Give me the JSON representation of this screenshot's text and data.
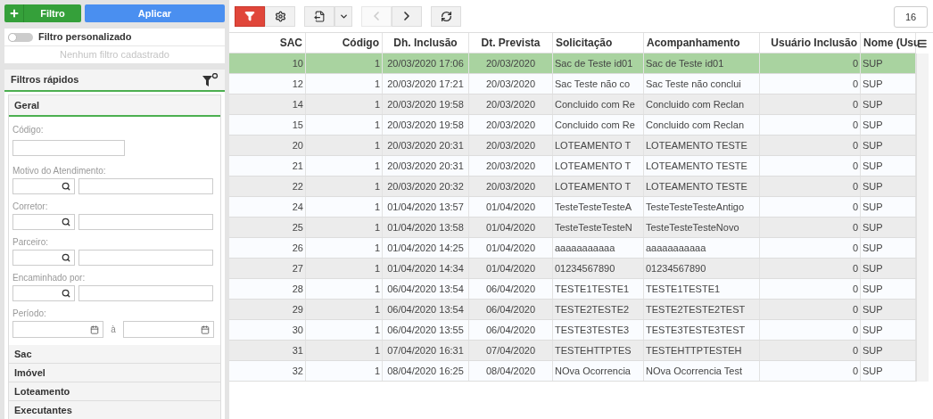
{
  "left_toolbar": {
    "add_button": "Filtro",
    "apply_button": "Aplicar"
  },
  "custom_filter": {
    "label": "Filtro personalizado",
    "on": false,
    "empty_message": "Nenhum filtro cadastrado"
  },
  "quick_filters": {
    "title": "Filtros rápidos",
    "sections": [
      {
        "title": "Geral",
        "expanded": true,
        "fields": [
          {
            "kind": "text",
            "label": "Código:"
          },
          {
            "kind": "lookup",
            "label": "Motivo do Atendimento:"
          },
          {
            "kind": "lookup",
            "label": "Corretor:"
          },
          {
            "kind": "lookup",
            "label": "Parceiro:"
          },
          {
            "kind": "lookup",
            "label": "Encaminhado por:"
          },
          {
            "kind": "date_range",
            "label": "Período:",
            "separator": "à"
          }
        ]
      },
      {
        "title": "Sac",
        "expanded": false
      },
      {
        "title": "Imóvel",
        "expanded": false
      },
      {
        "title": "Loteamento",
        "expanded": false
      },
      {
        "title": "Executantes",
        "expanded": false
      }
    ]
  },
  "toolbar": {
    "buttons": [
      {
        "kind": "filter",
        "active": true,
        "disabled": false
      },
      {
        "kind": "settings",
        "active": false,
        "disabled": false
      },
      {
        "kind": "export",
        "active": false,
        "disabled": false
      },
      {
        "kind": "export_menu",
        "active": false,
        "disabled": false
      },
      {
        "kind": "previous",
        "active": false,
        "disabled": true
      },
      {
        "kind": "next",
        "active": false,
        "disabled": false
      },
      {
        "kind": "refresh",
        "active": false,
        "disabled": false
      }
    ],
    "page_count": "16"
  },
  "table": {
    "columns": [
      "SAC",
      "Código",
      "Dh. Inclusão",
      "Dt. Prevista",
      "Solicitação",
      "Acompanhamento",
      "Usuário Inclusão",
      "Nome (Usu"
    ],
    "rows": [
      {
        "selected": true,
        "cells": [
          "10",
          "1",
          "20/03/2020 17:06",
          "20/03/2020",
          "Sac de Teste id01",
          "Sac de Teste id01",
          "0",
          "SUP"
        ]
      },
      {
        "selected": false,
        "cells": [
          "12",
          "1",
          "20/03/2020 17:21",
          "20/03/2020",
          "Sac Teste não co",
          "Sac Teste não conclui",
          "0",
          "SUP"
        ]
      },
      {
        "selected": false,
        "cells": [
          "14",
          "1",
          "20/03/2020 19:58",
          "20/03/2020",
          "Concluido com Re",
          "Concluido com Reclan",
          "0",
          "SUP"
        ]
      },
      {
        "selected": false,
        "cells": [
          "15",
          "1",
          "20/03/2020 19:58",
          "20/03/2020",
          "Concluido com Re",
          "Concluido com Reclan",
          "0",
          "SUP"
        ]
      },
      {
        "selected": false,
        "cells": [
          "20",
          "1",
          "20/03/2020 20:31",
          "20/03/2020",
          "LOTEAMENTO T",
          "LOTEAMENTO TESTE",
          "0",
          "SUP"
        ]
      },
      {
        "selected": false,
        "cells": [
          "21",
          "1",
          "20/03/2020 20:31",
          "20/03/2020",
          "LOTEAMENTO T",
          "LOTEAMENTO TESTE",
          "0",
          "SUP"
        ]
      },
      {
        "selected": false,
        "cells": [
          "22",
          "1",
          "20/03/2020 20:32",
          "20/03/2020",
          "LOTEAMENTO T",
          "LOTEAMENTO TESTE",
          "0",
          "SUP"
        ]
      },
      {
        "selected": false,
        "cells": [
          "24",
          "1",
          "01/04/2020 13:57",
          "01/04/2020",
          "TesteTesteTesteA",
          "TesteTesteTesteAntigo",
          "0",
          "SUP"
        ]
      },
      {
        "selected": false,
        "cells": [
          "25",
          "1",
          "01/04/2020 13:58",
          "01/04/2020",
          "TesteTesteTesteN",
          "TesteTesteTesteNovo",
          "0",
          "SUP"
        ]
      },
      {
        "selected": false,
        "cells": [
          "26",
          "1",
          "01/04/2020 14:25",
          "01/04/2020",
          "aaaaaaaaaaa",
          "aaaaaaaaaaa",
          "0",
          "SUP"
        ]
      },
      {
        "selected": false,
        "cells": [
          "27",
          "1",
          "01/04/2020 14:34",
          "01/04/2020",
          "01234567890",
          "01234567890",
          "0",
          "SUP"
        ]
      },
      {
        "selected": false,
        "cells": [
          "28",
          "1",
          "06/04/2020 13:54",
          "06/04/2020",
          "TESTE1TESTE1",
          "TESTE1TESTE1",
          "0",
          "SUP"
        ]
      },
      {
        "selected": false,
        "cells": [
          "29",
          "1",
          "06/04/2020 13:54",
          "06/04/2020",
          "TESTE2TESTE2",
          "TESTE2TESTE2TEST",
          "0",
          "SUP"
        ]
      },
      {
        "selected": false,
        "cells": [
          "30",
          "1",
          "06/04/2020 13:55",
          "06/04/2020",
          "TESTE3TESTE3",
          "TESTE3TESTE3TEST",
          "0",
          "SUP"
        ]
      },
      {
        "selected": false,
        "cells": [
          "31",
          "1",
          "07/04/2020 16:31",
          "07/04/2020",
          "TESTEHTTPTES",
          "TESTEHTTPTESTEH",
          "0",
          "SUP"
        ]
      },
      {
        "selected": false,
        "cells": [
          "32",
          "1",
          "08/04/2020 16:25",
          "08/04/2020",
          "NOva Ocorrencia",
          "NOva Ocorrencia Test",
          "0",
          "SUP"
        ]
      }
    ]
  }
}
